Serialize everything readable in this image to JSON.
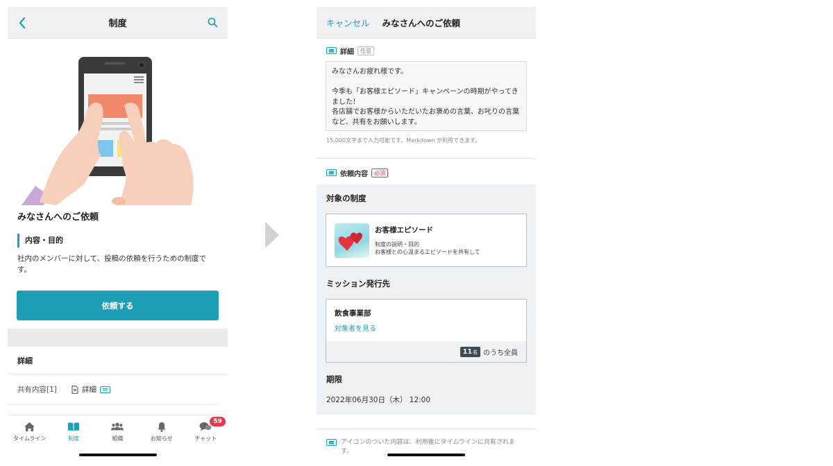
{
  "left": {
    "nav": {
      "title": "制度"
    },
    "page_title": "みなさんへのご依頼",
    "purpose_label": "内容・目的",
    "purpose_text": "社内のメンバーに対して、投稿の依頼を行うための制度です。",
    "request_button": "依頼する",
    "detail_header": "詳細",
    "share_label": "共有内容[1]",
    "share_doc": "詳細",
    "tabs": [
      {
        "label": "タイムライン",
        "icon": "home-icon"
      },
      {
        "label": "制度",
        "icon": "book-icon"
      },
      {
        "label": "組織",
        "icon": "people-icon"
      },
      {
        "label": "お知らせ",
        "icon": "bell-icon"
      },
      {
        "label": "チャット",
        "icon": "chat-icon",
        "badge": "59"
      }
    ]
  },
  "right": {
    "nav": {
      "cancel": "キャンセル",
      "title": "みなさんへのご依頼"
    },
    "detail_label": "詳細",
    "optional_tag": "任意",
    "message": "みなさんお疲れ様です。\n\n今季も「お客様エピソード」キャンペーンの時期がやってきました！\n各店舗でお客様からいただいたお褒めの言葉、お叱りの言葉など、共有をお願いします。",
    "hint": "15,000文字まで入力可能です。Markdown が利用できます。",
    "request_label": "依頼内容",
    "required_tag": "必須",
    "target_policy_heading": "対象の制度",
    "policy": {
      "title": "お客様エピソード",
      "desc1": "制度の説明・目的",
      "desc2": "お客様との心温まるエピソードを共有して"
    },
    "mission_heading": "ミッション発行先",
    "mission": {
      "dept": "飲食事業部",
      "see_link": "対象者を見る",
      "count": "11",
      "count_unit": "名",
      "count_suffix": "のうち全員"
    },
    "deadline_heading": "期限",
    "deadline": "2022年06月30日（木） 12:00",
    "footnote": "アイコンのついた内容は、利用後にタイムラインに共有されます。"
  },
  "colors": {
    "accent": "#1e9fb5",
    "badge": "#e53950"
  }
}
